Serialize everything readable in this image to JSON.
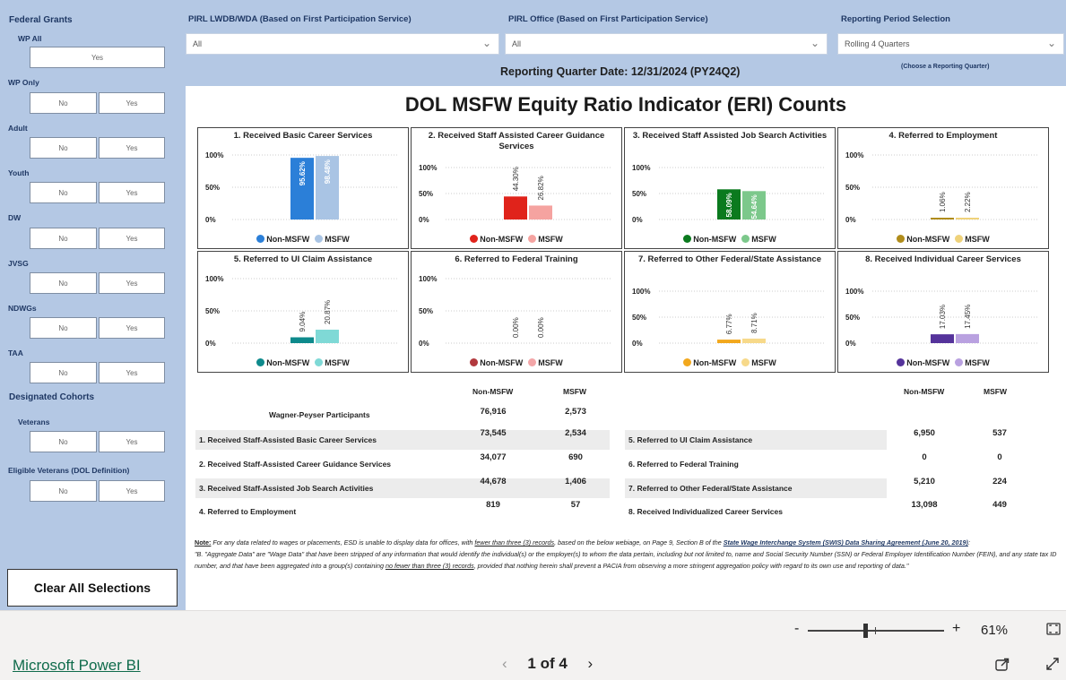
{
  "sidebar": {
    "title": "Federal Grants",
    "groups": [
      {
        "label": "WP All",
        "single": "Yes"
      },
      {
        "label": "WP Only",
        "no": "No",
        "yes": "Yes"
      },
      {
        "label": "Adult",
        "no": "No",
        "yes": "Yes"
      },
      {
        "label": "Youth",
        "no": "No",
        "yes": "Yes"
      },
      {
        "label": "DW",
        "no": "No",
        "yes": "Yes"
      },
      {
        "label": "JVSG",
        "no": "No",
        "yes": "Yes"
      },
      {
        "label": "NDWGs",
        "no": "No",
        "yes": "Yes"
      },
      {
        "label": "TAA",
        "no": "No",
        "yes": "Yes"
      }
    ],
    "cohorts_title": "Designated Cohorts",
    "cohorts": [
      {
        "label": "Veterans",
        "no": "No",
        "yes": "Yes"
      },
      {
        "label": "Eligible Veterans (DOL Definition)",
        "no": "No",
        "yes": "Yes"
      }
    ],
    "clear_label": "Clear All Selections"
  },
  "filters": {
    "lwdb": {
      "label": "PIRL LWDB/WDA (Based on First Participation Service)",
      "value": "All"
    },
    "office": {
      "label": "PIRL Office (Based on First Participation Service)",
      "value": "All"
    },
    "period": {
      "label": "Reporting Period Selection",
      "value": "Rolling 4 Quarters"
    },
    "quarter_date": "Reporting Quarter Date:  12/31/2024 (PY24Q2)",
    "quarter_hint": "(Choose a Reporting Quarter)"
  },
  "report_title": "DOL MSFW Equity Ratio Indicator (ERI) Counts",
  "chart_data": [
    {
      "type": "bar",
      "title": "1. Received Basic Career Services",
      "categories": [
        "Non-MSFW",
        "MSFW"
      ],
      "values": [
        95.62,
        98.48
      ],
      "labels": [
        "95.62%",
        "98.48%"
      ],
      "ylim": [
        0,
        100
      ],
      "ticks": [
        "100%",
        "50%",
        "0%"
      ],
      "colors": [
        "#2b7fd8",
        "#a9c4e4"
      ],
      "label_inside": true
    },
    {
      "type": "bar",
      "title": "2. Received Staff Assisted Career Guidance Services",
      "categories": [
        "Non-MSFW",
        "MSFW"
      ],
      "values": [
        44.3,
        26.82
      ],
      "labels": [
        "44.30%",
        "26.82%"
      ],
      "ylim": [
        0,
        100
      ],
      "ticks": [
        "100%",
        "50%",
        "0%"
      ],
      "colors": [
        "#e0231b",
        "#f5a3a0"
      ],
      "label_inside": false
    },
    {
      "type": "bar",
      "title": "3. Received Staff Assisted Job Search Activities",
      "categories": [
        "Non-MSFW",
        "MSFW"
      ],
      "values": [
        58.09,
        54.64
      ],
      "labels": [
        "58.09%",
        "54.64%"
      ],
      "ylim": [
        0,
        100
      ],
      "ticks": [
        "100%",
        "50%",
        "0%"
      ],
      "colors": [
        "#0b7a1e",
        "#7cc88b"
      ],
      "label_inside": true
    },
    {
      "type": "bar",
      "title": "4. Referred to Employment",
      "categories": [
        "Non-MSFW",
        "MSFW"
      ],
      "values": [
        1.06,
        2.22
      ],
      "labels": [
        "1.06%",
        "2.22%"
      ],
      "ylim": [
        0,
        100
      ],
      "ticks": [
        "100%",
        "50%",
        "0%"
      ],
      "colors": [
        "#b08c1a",
        "#efd27a"
      ],
      "label_inside": false
    },
    {
      "type": "bar",
      "title": "5. Referred to UI Claim Assistance",
      "categories": [
        "Non-MSFW",
        "MSFW"
      ],
      "values": [
        9.04,
        20.87
      ],
      "labels": [
        "9.04%",
        "20.87%"
      ],
      "ylim": [
        0,
        100
      ],
      "ticks": [
        "100%",
        "50%",
        "0%"
      ],
      "colors": [
        "#0e8a8c",
        "#7fd9d6"
      ],
      "label_inside": false
    },
    {
      "type": "bar",
      "title": "6. Referred to Federal Training",
      "categories": [
        "Non-MSFW",
        "MSFW"
      ],
      "values": [
        0.0,
        0.0
      ],
      "labels": [
        "0.00%",
        "0.00%"
      ],
      "ylim": [
        0,
        100
      ],
      "ticks": [
        "100%",
        "50%",
        "0%"
      ],
      "colors": [
        "#b2393e",
        "#f3a6a8"
      ],
      "label_inside": false
    },
    {
      "type": "bar",
      "title": "7. Referred to Other Federal/State Assistance",
      "categories": [
        "Non-MSFW",
        "MSFW"
      ],
      "values": [
        6.77,
        8.71
      ],
      "labels": [
        "6.77%",
        "8.71%"
      ],
      "ylim": [
        0,
        100
      ],
      "ticks": [
        "100%",
        "50%",
        "0%"
      ],
      "colors": [
        "#f2a81d",
        "#f7d98a"
      ],
      "label_inside": false
    },
    {
      "type": "bar",
      "title": "8. Received Individual Career Services",
      "categories": [
        "Non-MSFW",
        "MSFW"
      ],
      "values": [
        17.03,
        17.45
      ],
      "labels": [
        "17.03%",
        "17.45%"
      ],
      "ylim": [
        0,
        100
      ],
      "ticks": [
        "100%",
        "50%",
        "0%"
      ],
      "colors": [
        "#55339b",
        "#b9a1e0"
      ],
      "label_inside": false
    }
  ],
  "table": {
    "col_non": "Non-MSFW",
    "col_msfw": "MSFW",
    "wp_label": "Wagner-Peyser Participants",
    "wp_non": "76,916",
    "wp_msfw": "2,573",
    "left_rows": [
      {
        "label": "1. Received Staff-Assisted Basic Career Services",
        "non": "73,545",
        "msfw": "2,534"
      },
      {
        "label": "2. Received Staff-Assisted Career Guidance Services",
        "non": "34,077",
        "msfw": "690"
      },
      {
        "label": "3. Received Staff-Assisted Job Search Activities",
        "non": "44,678",
        "msfw": "1,406"
      },
      {
        "label": "4. Referred to Employment",
        "non": "819",
        "msfw": "57"
      }
    ],
    "right_rows": [
      {
        "label": "5. Referred to UI Claim Assistance",
        "non": "6,950",
        "msfw": "537"
      },
      {
        "label": "6. Referred to Federal Training",
        "non": "0",
        "msfw": "0"
      },
      {
        "label": "7. Referred to Other Federal/State Assistance",
        "non": "5,210",
        "msfw": "224"
      },
      {
        "label": "8. Received Individualized Career Services",
        "non": "13,098",
        "msfw": "449"
      }
    ]
  },
  "note": {
    "prefix": "Note:",
    "text1": " For any data related to wages or placements, ESD is unable to display data for offices, with ",
    "u1": "fewer than three (3) records",
    "text2": ", based on the below webiage, on Page 9, Section B of the ",
    "link": "State Wage Interchange System (SWIS) Data Sharing Agreement (June 20, 2019)",
    "text3": ":",
    "quote1": "\"B. \"Aggregate Data\" are \"Wage Data\" that have been stripped of any information that would identify the individual(s) or the employer(s) to whom the data pertain, including but not limited to, name and Social Security Number (SSN) or Federal Employer Identification Number (FEIN), and any state tax ID number, and that have been aggregated into a group(s) containing ",
    "u2": "no fewer than three (3) records",
    "quote2": ", provided that nothing herein shall prevent a PACIA from observing a more stringent aggregation policy with regard to its own use and reporting of data.\""
  },
  "footer": {
    "zoom_minus": "-",
    "zoom_plus": "+",
    "zoom_level": "61%",
    "zoom_fraction": 0.24,
    "brand": "Microsoft Power BI",
    "page_indicator": "1 of 4",
    "prev": "‹",
    "next": "›"
  }
}
